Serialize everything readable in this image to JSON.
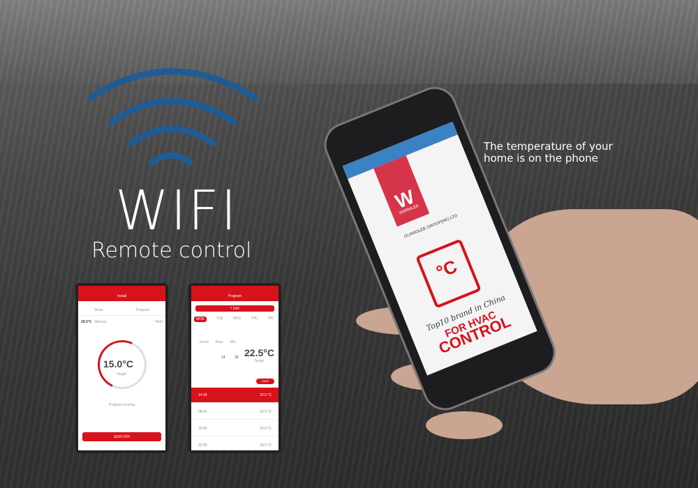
{
  "headline": {
    "title": "WIFI",
    "subtitle": "Remote control"
  },
  "tagline": {
    "line1": "The temperature of your",
    "line2": "home is on  the phone"
  },
  "screen_left": {
    "header": "Install",
    "tabs": [
      "Mode",
      "Program"
    ],
    "status": "28.0°C",
    "manual_label": "Manual",
    "hold_label": "Hold",
    "setpoint": "15.0°C",
    "target_label": "Target",
    "program_label": "Program running",
    "button": "SIGN OFF"
  },
  "screen_middle": {
    "header": "Program",
    "pill": "7 DAY",
    "days": [
      "MON",
      "TUE",
      "WED",
      "THU",
      "FRI"
    ],
    "col_labels": [
      "Event",
      "Hour",
      "Min"
    ],
    "hour": "14",
    "minute": "30",
    "setpoint": "22.5°C",
    "target_label": "Target",
    "save_button": "SAVE",
    "rows": [
      {
        "time": "14:30",
        "temp": "22.5 °C"
      },
      {
        "time": "08:00",
        "temp": "30.0 °C"
      },
      {
        "time": "16:00",
        "temp": "16.0 °C"
      },
      {
        "time": "22:00",
        "temp": "28.0 °C"
      }
    ]
  },
  "big_phone": {
    "logo_text": "WARMLEE",
    "company": "GUANGLEE GROUP(HK) LTD",
    "celsius": "°C",
    "slogan": "Top10 brand in China",
    "title1": "FOR HVAC",
    "title2": "CONTROL"
  },
  "colors": {
    "accent": "#d6121b",
    "wifi": "#1f5c93"
  }
}
